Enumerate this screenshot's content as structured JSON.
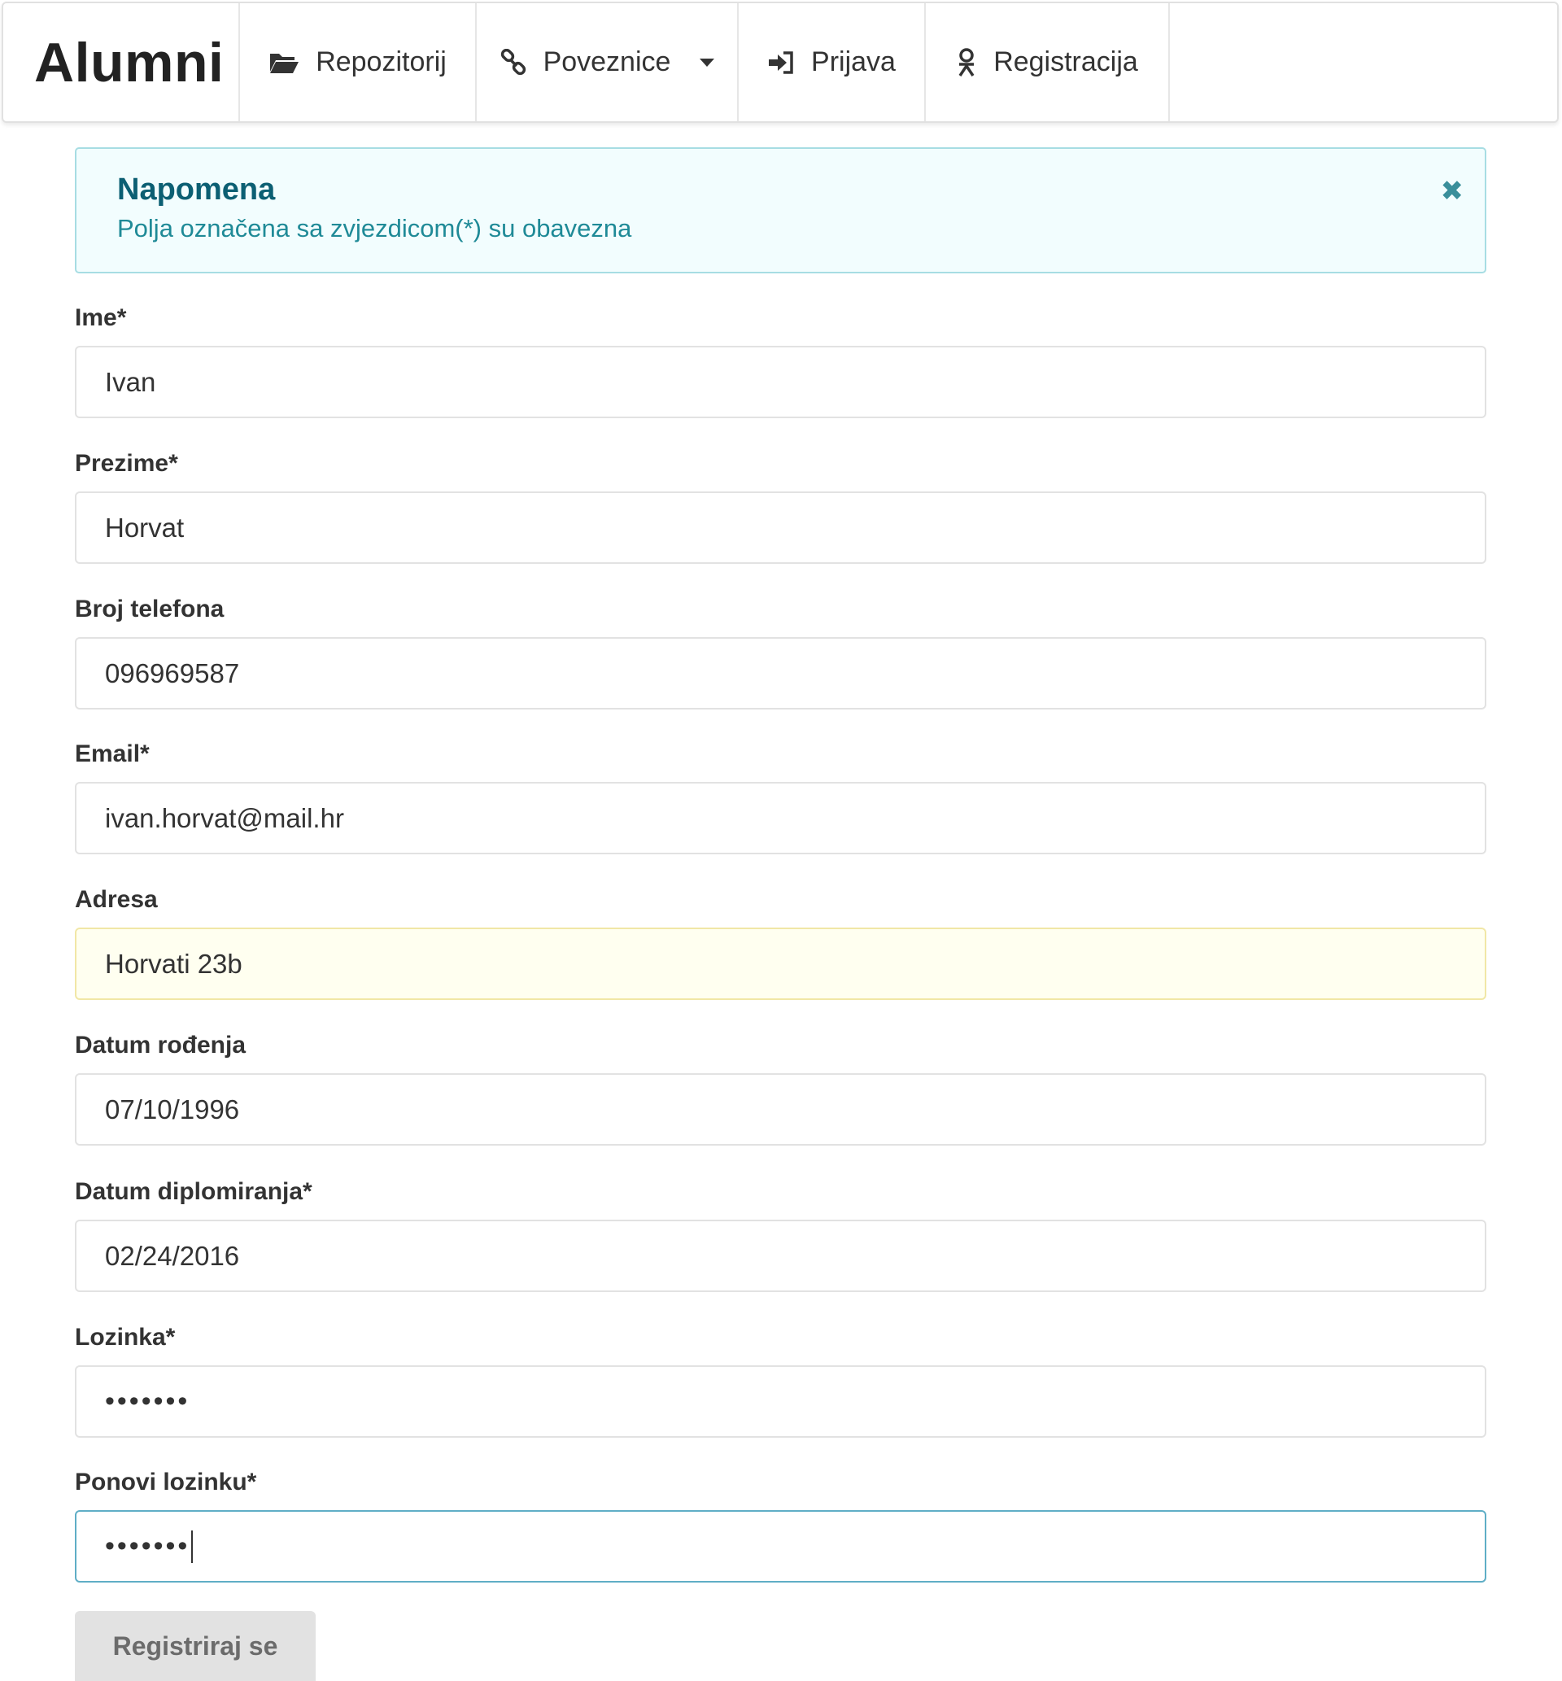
{
  "navbar": {
    "brand": "Alumni",
    "items": [
      {
        "label": "Repozitorij",
        "icon": "folder-open-icon"
      },
      {
        "label": "Poveznice",
        "icon": "link-icon",
        "has_dropdown": true
      },
      {
        "label": "Prijava",
        "icon": "sign-in-icon"
      },
      {
        "label": "Registracija",
        "icon": "user-icon"
      }
    ]
  },
  "alert": {
    "title": "Napomena",
    "text": "Polja označena sa zvjezdicom(*) su obavezna",
    "close_glyph": "✖",
    "color": "#0c5f73"
  },
  "form": {
    "fields": [
      {
        "label": "Ime*",
        "value": "Ivan"
      },
      {
        "label": "Prezime*",
        "value": "Horvat"
      },
      {
        "label": "Broj telefona",
        "value": "096969587"
      },
      {
        "label": "Email*",
        "value": "ivan.horvat@mail.hr"
      },
      {
        "label": "Adresa",
        "value": "Horvati 23b"
      },
      {
        "label": "Datum rođenja",
        "value": "07/10/1996"
      },
      {
        "label": "Datum diplomiranja*",
        "value": "02/24/2016"
      },
      {
        "label": "Lozinka*",
        "value": "•••••••"
      },
      {
        "label": "Ponovi lozinku*",
        "value": "•••••••"
      }
    ],
    "submit_label": "Registriraj se"
  }
}
